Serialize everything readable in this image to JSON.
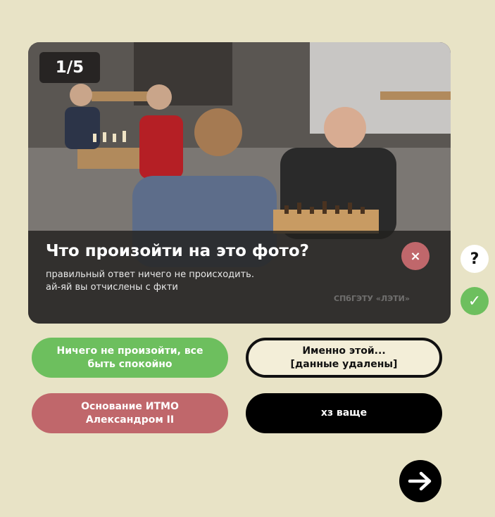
{
  "quiz": {
    "counter": "1/5",
    "question": "Что произойти на это фото?",
    "answer_line1": "правильный ответ ничего не происходить.",
    "answer_line2": "ай-яй вы отчислены с фкти",
    "watermark": "СПбГЭТУ «ЛЭТИ»",
    "close_symbol": "×",
    "help_symbol": "?",
    "check_symbol": "✓",
    "options": [
      {
        "line1": "Ничего не произойти, все",
        "line2": "быть спокойно",
        "color": "#6dbf5e"
      },
      {
        "line1": "Именно этой...",
        "line2": "[данные удалены]",
        "color": "#f3eed8"
      },
      {
        "line1": "Основание ИТМО",
        "line2": "Александром II",
        "color": "#c0676b"
      },
      {
        "line1": "хз ваще",
        "line2": "",
        "color": "#000000"
      }
    ],
    "next_icon": "arrow-right-icon"
  },
  "colors": {
    "background": "#e8e3c6",
    "accent_green": "#6dbf5e",
    "accent_red": "#c0676b"
  }
}
